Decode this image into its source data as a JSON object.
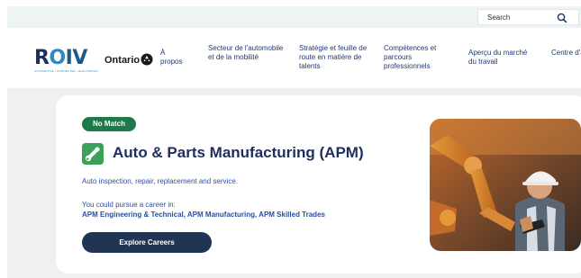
{
  "header": {
    "search": {
      "placeholder": "Search",
      "value": "",
      "icon": "search-icon"
    }
  },
  "nav": {
    "logo": {
      "text_parts": [
        "R",
        "O",
        "IV"
      ],
      "tagline": "AUTOMOTIVE • CONNECTED • ELECTRIFIED"
    },
    "ontario_label": "Ontario",
    "ontario_icon": "trillium-icon",
    "links": [
      {
        "label": "À propos"
      },
      {
        "label": "Secteur de l'automobile et de la mobilité"
      },
      {
        "label": "Stratégie et feuille de route en matière de talents"
      },
      {
        "label": "Compétences et parcours professionnels"
      },
      {
        "label": "Aperçu du marché du travail"
      },
      {
        "label": "Centre d'appren"
      }
    ]
  },
  "card": {
    "badge": "No Match",
    "icon": "wrench-icon",
    "title": "Auto & Parts Manufacturing (APM)",
    "description": "Auto inspection, repair, replacement and service.",
    "pursue_label": "You could pursue a career in:",
    "careers": "APM Engineering & Technical, APM Manufacturing, APM Skilled Trades",
    "button_label": "Explore Careers",
    "image": "engineer-robot-arm-photo"
  },
  "colors": {
    "navy": "#1f2f5c",
    "link_blue": "#2c4ea0",
    "badge_green": "#1e7a4a",
    "button_dark": "#1f3553",
    "topbar_bg": "#eef4f3",
    "band_bg": "#eff1f0"
  }
}
